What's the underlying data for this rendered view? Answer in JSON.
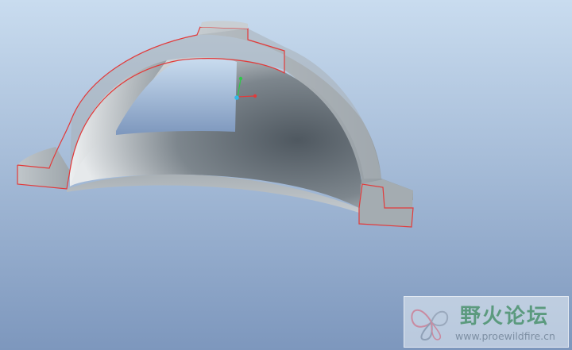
{
  "window": {
    "title": ""
  },
  "viewport": {
    "background_top": "#c9dcef",
    "background_bottom": "#7d97bd",
    "model_color": "#9aa3aa",
    "edge_highlight_color": "#e23a3a",
    "axis_x_color": "#e23a3a",
    "axis_y_color": "#2ec84a",
    "axis_origin_color": "#32b8e8"
  },
  "watermark": {
    "title": "野火论坛",
    "url": "www.proewildfire.cn",
    "logo_icon": "butterfly-logo-icon"
  }
}
